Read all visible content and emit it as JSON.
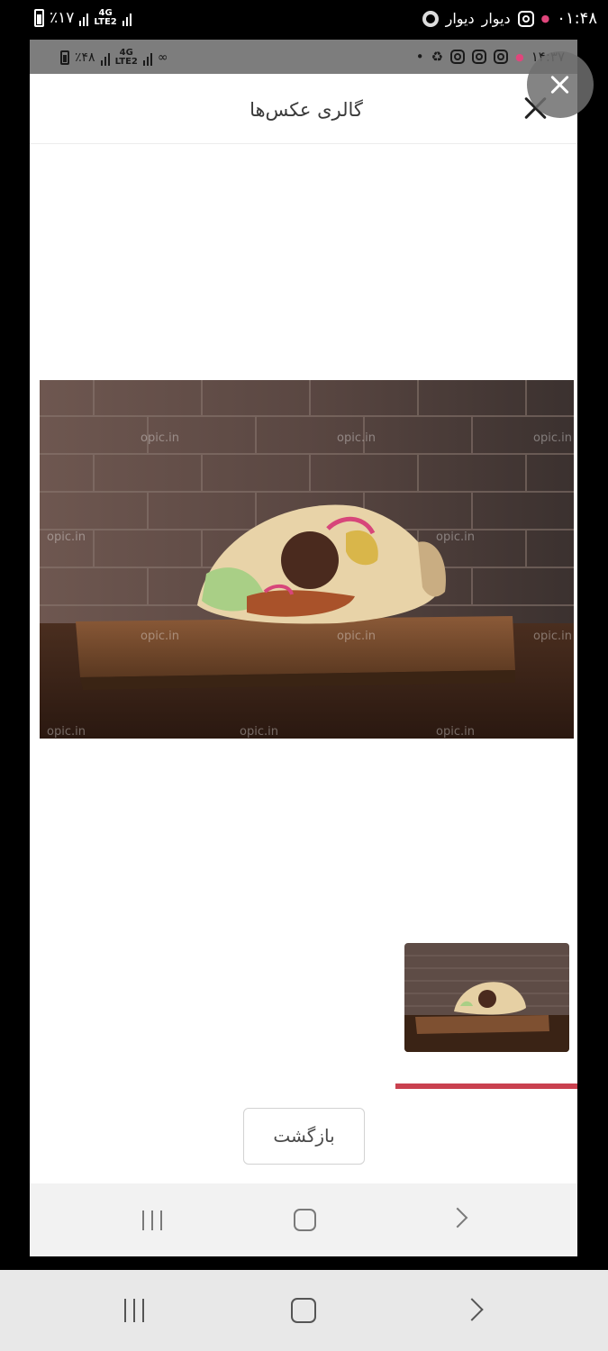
{
  "outer_status": {
    "time": "۰۱:۴۸",
    "app_1": "دیوار",
    "app_2": "دیوار",
    "battery": "٪۱۷",
    "network": "4G",
    "network_2": "LTE2"
  },
  "inner_status": {
    "time": "۱۴:۳۷",
    "battery": "٪۴۸",
    "network": "4G",
    "network_2": "LTE2"
  },
  "header": {
    "title": "گالری عکس‌ها"
  },
  "gallery": {
    "main_image": "wrap-sandwich-photo",
    "watermark": "opic.in",
    "thumbnail_count": 1
  },
  "actions": {
    "back_label": "بازگشت"
  },
  "colors": {
    "accent": "#c9414f",
    "header_bg": "#ffffff",
    "nav_bg": "#f2f2f2"
  },
  "icons": {
    "close": "close-icon",
    "recents": "recents-icon",
    "home": "home-icon",
    "back": "back-chevron-icon"
  }
}
